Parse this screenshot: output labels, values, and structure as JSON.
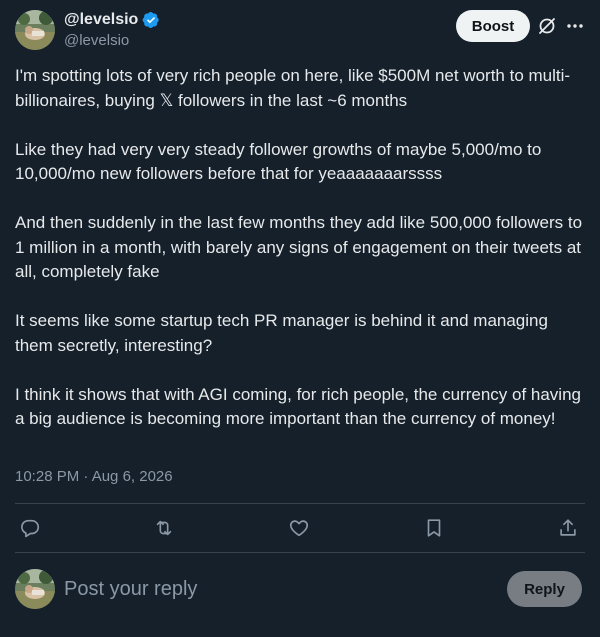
{
  "author": {
    "display_name": "@levelsio",
    "handle": "@levelsio",
    "verified": true,
    "avatar_icon": "avatar-photo-icon"
  },
  "header": {
    "boost_label": "Boost",
    "grok_icon": "slash-circle-icon",
    "more_icon": "more-horizontal-icon"
  },
  "tweet": {
    "paragraphs": [
      "I'm spotting lots of very rich people on here, like $500M net worth to multi-billionaires, buying 𝕏 followers in the last ~6 months",
      "Like they had very very steady follower growths of maybe 5,000/mo to 10,000/mo new followers before that for yeaaaaaaarssss",
      "And then suddenly in the last few months they add like 500,000 followers to 1 million in a month, with barely any signs of engagement on their tweets at all, completely fake",
      "It seems like some startup tech PR manager is behind it and managing them secretly, interesting?",
      "I think it shows that with AGI coming, for rich people, the currency of having a big audience is becoming more important than the currency of money!"
    ],
    "timestamp": "10:28 PM · Aug 6, 2026"
  },
  "actions": {
    "reply_icon": "reply-icon",
    "repost_icon": "repost-icon",
    "like_icon": "heart-icon",
    "bookmark_icon": "bookmark-icon",
    "share_icon": "share-icon"
  },
  "composer": {
    "placeholder": "Post your reply",
    "reply_label": "Reply"
  },
  "colors": {
    "background": "#15202b",
    "text": "#e7e9ea",
    "secondary_text": "#8b98a5",
    "verified": "#1d9bf0",
    "divider": "#38444d"
  }
}
